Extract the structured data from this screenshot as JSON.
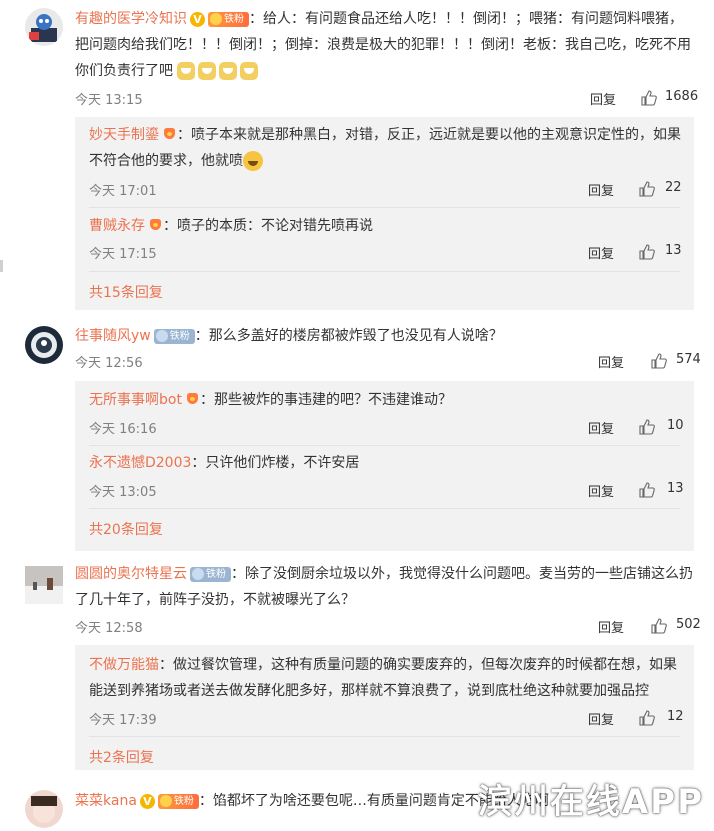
{
  "threads": [
    {
      "author": "有趣的医学冷知识",
      "fan_badge": "铁粉",
      "text": "：给人：有问题食品还给人吃！！！倒闭！；喂猪：有问题饲料喂猪，把问题肉给我们吃！！！倒闭！；倒掉：浪费是极大的犯罪！！！倒闭！老板：我自己吃，吃死不用你们负责行了吧",
      "time": "今天 13:15",
      "reply_label": "回复",
      "likes": "1686",
      "subs": [
        {
          "author": "妙天手制ड़ऺ",
          "author_display": "妙天手制鎏",
          "text": "：喷子本来就是那种黑白，对错，反正，远近就是要以他的主观意识定性的，如果不符合他的要求，他就喷",
          "time": "今天 17:01",
          "likes": "22"
        },
        {
          "author": "曹贼永存",
          "text": "：喷子的本质：不论对错先喷再说",
          "time": "今天 17:15",
          "likes": "13"
        }
      ],
      "more": "共15条回复"
    },
    {
      "author": "往事随风yw",
      "fan_badge": "铁粉",
      "text": "：那么多盖好的楼房都被炸毁了也没见有人说啥？",
      "time": "今天 12:56",
      "reply_label": "回复",
      "likes": "574",
      "subs": [
        {
          "author": "无所事事啊bot",
          "text": "：那些被炸的事违建的吧？不违建谁动？",
          "time": "今天 16:16",
          "likes": "10"
        },
        {
          "author": "永不遗憾D2003",
          "text": "：只许他们炸楼，不许安居",
          "time": "今天 13:05",
          "likes": "13"
        }
      ],
      "more": "共20条回复"
    },
    {
      "author": "圆圆的奥尔特星云",
      "fan_badge": "铁粉",
      "text": "：除了没倒厨余垃圾以外，我觉得没什么问题吧。麦当劳的一些店铺这么扔了几十年了，前阵子没扔，不就被曝光了么？",
      "time": "今天 12:58",
      "reply_label": "回复",
      "likes": "502",
      "subs": [
        {
          "author": "不做万能猫",
          "text": "：做过餐饮管理，这种有质量问题的确实要废弃的，但每次废弃的时候都在想，如果能送到养猪场或者送去做发酵化肥多好，那样就不算浪费了，说到底杜绝这种就要加强品控",
          "time": "今天 17:39",
          "likes": "12"
        }
      ],
      "more": "共2条回复"
    },
    {
      "author": "菜菜kana",
      "fan_badge": "铁粉",
      "text": "：馅都坏了为啥还要包呢…有质量问题肯定不能给人吃啊"
    }
  ],
  "watermark": "滨州在线APP",
  "colors": {
    "name": "#eb7350",
    "sub_bg": "#f2f2f2",
    "vip": "#f7b500"
  }
}
